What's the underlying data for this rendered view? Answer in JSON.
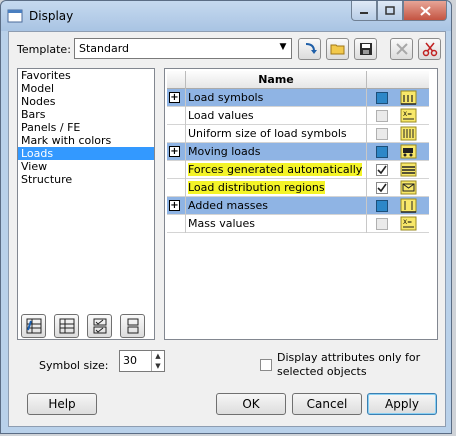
{
  "window": {
    "title": "Display"
  },
  "template": {
    "label": "Template:",
    "value": "Standard"
  },
  "toolbar_icons": [
    "apply-template-icon",
    "open-folder-icon",
    "save-icon",
    "delete-icon",
    "cut-icon"
  ],
  "sidebar": {
    "items": [
      {
        "label": "Favorites"
      },
      {
        "label": "Model"
      },
      {
        "label": "Nodes"
      },
      {
        "label": "Bars"
      },
      {
        "label": "Panels / FE"
      },
      {
        "label": "Mark with colors"
      },
      {
        "label": "Loads",
        "selected": true
      },
      {
        "label": "View"
      },
      {
        "label": "Structure"
      }
    ]
  },
  "grid": {
    "header": {
      "name": "Name"
    },
    "rows": [
      {
        "label": "Load symbols",
        "group": true,
        "check": "blue",
        "icon": "load-symbols-icon"
      },
      {
        "label": "Load values",
        "group": false,
        "check": "disabled",
        "icon": "load-values-icon"
      },
      {
        "label": "Uniform size of load symbols",
        "group": false,
        "check": "disabled",
        "icon": "uniform-size-icon"
      },
      {
        "label": "Moving loads",
        "group": true,
        "check": "blue",
        "icon": "moving-loads-icon"
      },
      {
        "label": "Forces generated automatically",
        "group": false,
        "highlighted": true,
        "check": "checked",
        "icon": "forces-generated-icon"
      },
      {
        "label": "Load distribution regions",
        "group": false,
        "highlighted": true,
        "check": "checked",
        "icon": "load-distribution-icon"
      },
      {
        "label": "Added masses",
        "group": true,
        "check": "blue",
        "icon": "added-masses-icon"
      },
      {
        "label": "Mass values",
        "group": false,
        "check": "disabled",
        "icon": "mass-values-icon"
      }
    ]
  },
  "bottom_icons": [
    "select-all-icon",
    "deselect-all-icon",
    "check-all-icon",
    "uncheck-all-icon"
  ],
  "symbol_size": {
    "label": "Symbol size:",
    "value": "30"
  },
  "attributes_checkbox": {
    "label": "Display attributes only for selected objects",
    "checked": false
  },
  "buttons": {
    "help": "Help",
    "ok": "OK",
    "cancel": "Cancel",
    "apply": "Apply"
  },
  "colors": {
    "selection": "#3399ff",
    "group_row": "#8fb4e4",
    "highlight": "#f4f428",
    "window_frame": "#b9d1ea"
  }
}
